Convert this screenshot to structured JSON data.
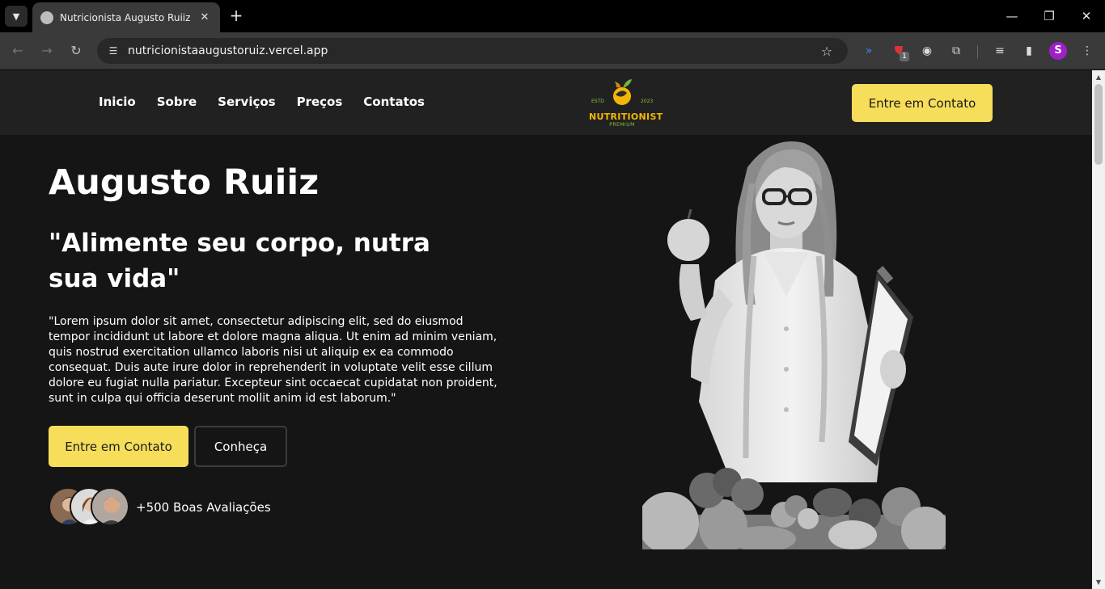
{
  "browser": {
    "tab_title": "Nutricionista Augusto Ruiiz Port",
    "new_tab_icon": "+",
    "close_tab_icon": "✕",
    "url": "nutricionistaaugustoruiz.vercel.app",
    "extension_badge": "1",
    "profile_initial": "S",
    "minimize_icon": "—",
    "restore_icon": "❐",
    "close_icon": "✕"
  },
  "nav": {
    "items": [
      "Inicio",
      "Sobre",
      "Serviços",
      "Preços",
      "Contatos"
    ]
  },
  "logo": {
    "estd": "ESTD",
    "year": "2023",
    "brand": "NUTRITIONIST",
    "sub": "PREMIUM"
  },
  "header": {
    "cta_label": "Entre em Contato"
  },
  "hero": {
    "name": "Augusto Ruiiz",
    "tagline": "\"Alimente seu corpo, nutra sua vida\"",
    "body": "\"Lorem ipsum dolor sit amet, consectetur adipiscing elit, sed do eiusmod tempor incididunt ut labore et dolore magna aliqua. Ut enim ad minim veniam, quis nostrud exercitation ullamco laboris nisi ut aliquip ex ea commodo consequat. Duis aute irure dolor in reprehenderit in voluptate velit esse cillum dolore eu fugiat nulla pariatur. Excepteur sint occaecat cupidatat non proident, sunt in culpa qui officia deserunt mollit anim id est laborum.\"",
    "primary_button": "Entre em Contato",
    "secondary_button": "Conheça",
    "reviews": "+500 Boas Avaliações"
  },
  "colors": {
    "accent": "#f6dd5a",
    "background": "#151515",
    "header": "#212121"
  }
}
